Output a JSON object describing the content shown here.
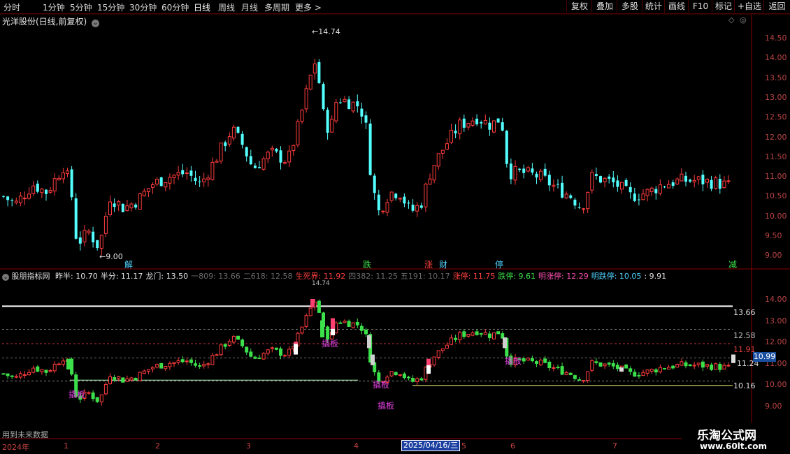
{
  "menu": {
    "periods": [
      "分时",
      "1分钟",
      "5分钟",
      "15分钟",
      "30分钟",
      "60分钟",
      "日线",
      "周线",
      "月线",
      "多周期",
      "更多 >"
    ],
    "active_period": "日线",
    "right_buttons": [
      "复权",
      "叠加",
      "多股",
      "统计",
      "画线",
      "F10",
      "+自选",
      "返回"
    ]
  },
  "chart_title": "光洋股份(日线,前复权)",
  "price_axis": [
    "14.50",
    "14.00",
    "13.50",
    "13.00",
    "12.50",
    "12.00",
    "11.50",
    "11.00",
    "10.50",
    "10.00",
    "9.50",
    "9.00"
  ],
  "high_label": "14.74",
  "low_label": "9.00",
  "event_markers": [
    {
      "text": "解",
      "color": "#4fd3ff"
    },
    {
      "text": "跌",
      "color": "#3ce04a"
    },
    {
      "text": "涨",
      "color": "#ff4040"
    },
    {
      "text": "财",
      "color": "#4fd3ff"
    },
    {
      "text": "停",
      "color": "#4fd3ff"
    },
    {
      "text": "减",
      "color": "#3ce04a"
    }
  ],
  "indicator": {
    "name": "股朋指标网",
    "items": [
      {
        "text": "昨半: 10.70",
        "color": "#e0e0e0"
      },
      {
        "text": "半分: 11.17",
        "color": "#e0e0e0"
      },
      {
        "text": "龙门: 13.50",
        "color": "#e0e0e0"
      },
      {
        "text": "一809: 13.66",
        "color": "#6a6a6a"
      },
      {
        "text": "二618: 12.58",
        "color": "#6a6a6a"
      },
      {
        "text": "生死界: 11.92",
        "color": "#ff4040"
      },
      {
        "text": "四382: 11.25",
        "color": "#6a6a6a"
      },
      {
        "text": "五191: 10.17",
        "color": "#6a6a6a"
      },
      {
        "text": "涨停: 11.75",
        "color": "#ff4040"
      },
      {
        "text": "跌停: 9.61",
        "color": "#3ce04a"
      },
      {
        "text": "明涨停: 12.29",
        "color": "#ff4fb0"
      },
      {
        "text": "明跌停: 10.05",
        "color": "#4fd3ff"
      },
      {
        "text": ": 9.91",
        "color": "#e0e0e0"
      }
    ],
    "axis": [
      "14.00",
      "13.00",
      "12.00",
      "11.00",
      "10.00",
      "9.00"
    ],
    "level_labels": [
      "13.66",
      "12.58",
      "11.91",
      "11.24",
      "10.16"
    ],
    "current_value": "10.99",
    "signal_label": "撬板",
    "peak_label": "14.74"
  },
  "future_data_text": "用到未来数据",
  "time_axis": {
    "year": "2024年",
    "months": [
      "1",
      "2",
      "3",
      "4",
      "5",
      "6",
      "7"
    ],
    "cursor_date": "2025/04/16/三"
  },
  "watermark": {
    "title": "乐淘公式网",
    "url": "www.60lt.com"
  }
}
